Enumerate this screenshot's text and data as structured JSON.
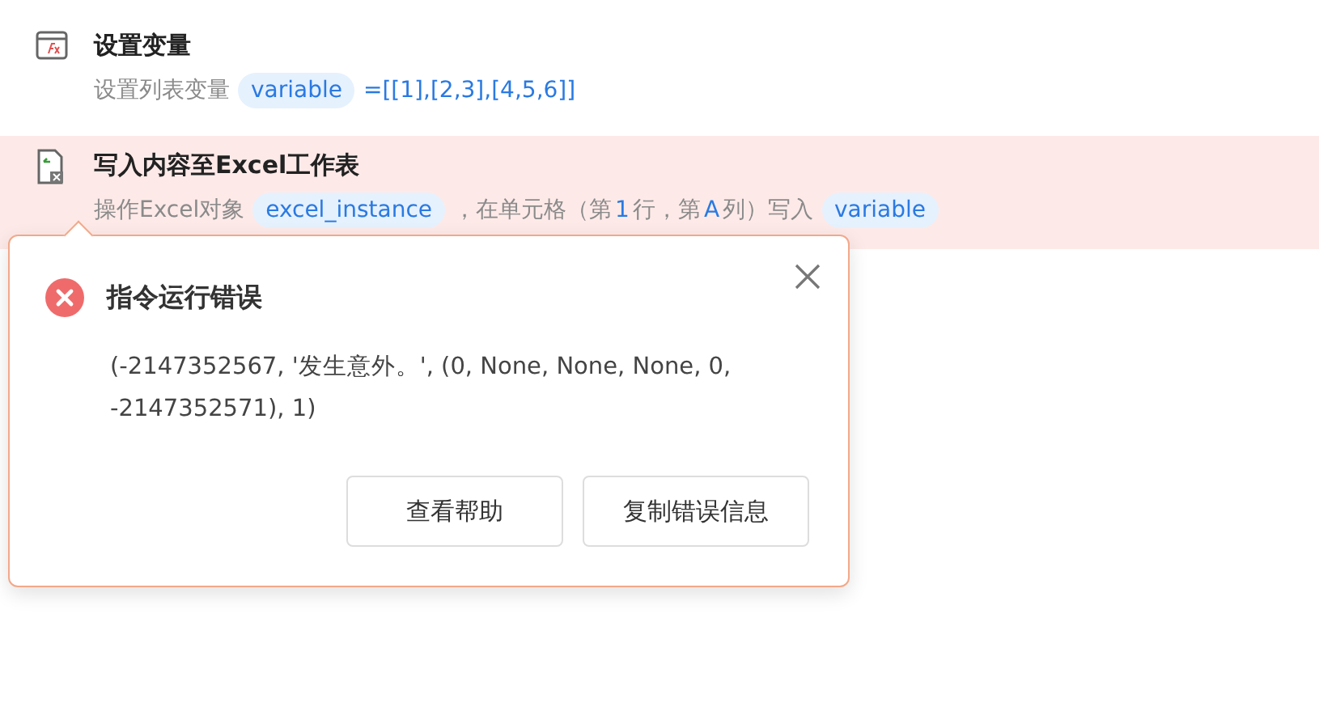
{
  "steps": [
    {
      "kind": "variable",
      "title": "设置变量",
      "error": false,
      "description": [
        {
          "kind": "text",
          "text": "设置列表变量"
        },
        {
          "kind": "tag",
          "text": "variable"
        },
        {
          "kind": "value",
          "text": "=[[1],[2,3],[4,5,6]]"
        }
      ]
    },
    {
      "kind": "excel",
      "title": "写入内容至Excel工作表",
      "error": true,
      "description": [
        {
          "kind": "text",
          "text": "操作Excel对象"
        },
        {
          "kind": "tag",
          "text": "excel_instance"
        },
        {
          "kind": "text",
          "text": "，在单元格（第"
        },
        {
          "kind": "value",
          "text": "1"
        },
        {
          "kind": "text",
          "text": "行，第"
        },
        {
          "kind": "value",
          "text": "A"
        },
        {
          "kind": "text",
          "text": "列）写入"
        },
        {
          "kind": "tag",
          "text": "variable"
        }
      ]
    }
  ],
  "error_popup": {
    "title": "指令运行错误",
    "message": "(-2147352567, '发生意外。', (0, None, None, None, 0, -2147352571), 1)",
    "buttons": [
      "查看帮助",
      "复制错误信息"
    ]
  }
}
